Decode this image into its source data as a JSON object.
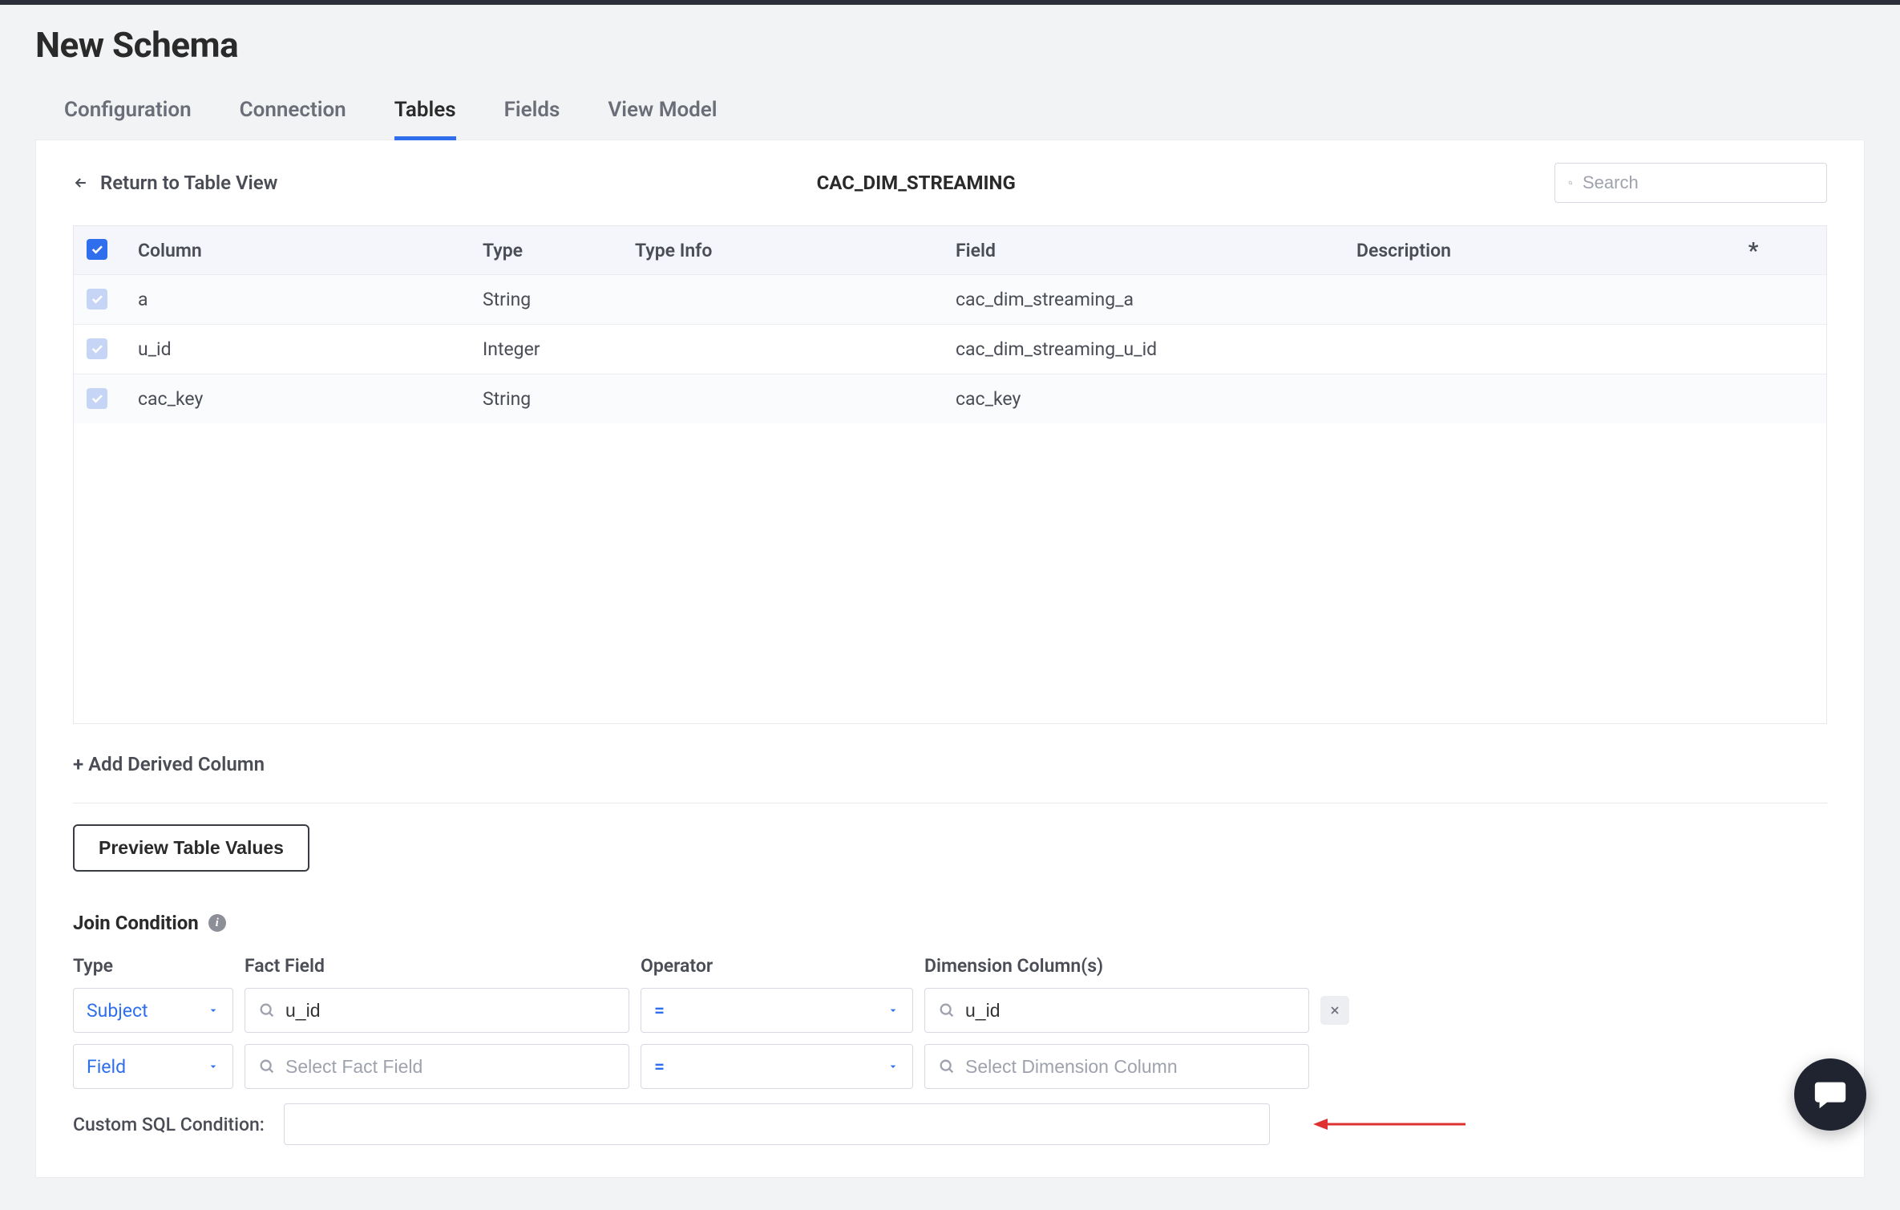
{
  "page": {
    "title": "New Schema"
  },
  "tabs": [
    {
      "label": "Configuration",
      "active": false
    },
    {
      "label": "Connection",
      "active": false
    },
    {
      "label": "Tables",
      "active": true
    },
    {
      "label": "Fields",
      "active": false
    },
    {
      "label": "View Model",
      "active": false
    }
  ],
  "tableView": {
    "returnLabel": "Return to Table View",
    "tableName": "CAC_DIM_STREAMING",
    "searchPlaceholder": "Search"
  },
  "columns": {
    "headers": {
      "column": "Column",
      "type": "Type",
      "typeInfo": "Type Info",
      "field": "Field",
      "description": "Description",
      "flag": "*"
    },
    "rows": [
      {
        "name": "a",
        "type": "String",
        "typeInfo": "",
        "field": "cac_dim_streaming_a",
        "description": ""
      },
      {
        "name": "u_id",
        "type": "Integer",
        "typeInfo": "",
        "field": "cac_dim_streaming_u_id",
        "description": ""
      },
      {
        "name": "cac_key",
        "type": "String",
        "typeInfo": "",
        "field": "cac_key",
        "description": ""
      }
    ]
  },
  "actions": {
    "addDerived": "+ Add Derived Column",
    "preview": "Preview Table Values"
  },
  "joinCondition": {
    "title": "Join Condition",
    "headers": {
      "type": "Type",
      "factField": "Fact Field",
      "operator": "Operator",
      "dimensionColumns": "Dimension Column(s)"
    },
    "rows": [
      {
        "type": "Subject",
        "factField": "u_id",
        "factFieldPlaceholder": "",
        "operator": "=",
        "dimension": "u_id",
        "dimensionPlaceholder": "",
        "removable": true
      },
      {
        "type": "Field",
        "factField": "",
        "factFieldPlaceholder": "Select Fact Field",
        "operator": "=",
        "dimension": "",
        "dimensionPlaceholder": "Select Dimension Column",
        "removable": false
      }
    ],
    "customSqlLabel": "Custom SQL Condition:",
    "customSqlValue": ""
  }
}
